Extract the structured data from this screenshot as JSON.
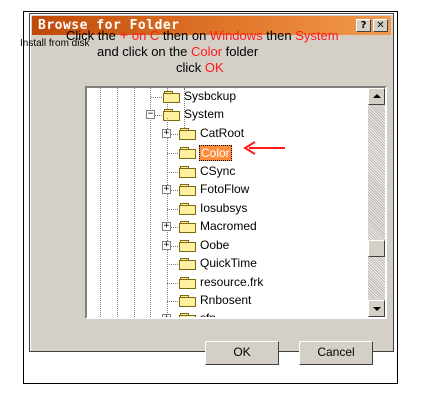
{
  "dialog": {
    "title": "Browse for Folder",
    "help_button": "?",
    "close_button": "✕",
    "ok_label": "OK",
    "cancel_label": "Cancel"
  },
  "instructions": {
    "line1_a": "Click the ",
    "line1_plus": "+",
    "line1_b": " on C",
    "line1_c": " then on ",
    "line1_d": "Windows",
    "line1_e": " then ",
    "line1_f": "System",
    "side_note": "Install from disk",
    "line2_a": "and click on the ",
    "line2_b": "Color",
    "line2_c": " folder",
    "line3_a": "click ",
    "line3_b": "OK"
  },
  "tree": {
    "items": [
      {
        "label": "Sysbckup",
        "expander": ""
      },
      {
        "label": "System",
        "expander": "−"
      },
      {
        "label": "CatRoot",
        "expander": "+"
      },
      {
        "label": "Color",
        "expander": "",
        "selected": true
      },
      {
        "label": "CSync",
        "expander": ""
      },
      {
        "label": "FotoFlow",
        "expander": "+"
      },
      {
        "label": "Iosubsys",
        "expander": ""
      },
      {
        "label": "Macromed",
        "expander": "+"
      },
      {
        "label": "Oobe",
        "expander": "+"
      },
      {
        "label": "QuickTime",
        "expander": ""
      },
      {
        "label": "resource.frk",
        "expander": ""
      },
      {
        "label": "Rnbosent",
        "expander": ""
      },
      {
        "label": "sfp",
        "expander": "+"
      }
    ]
  },
  "colors": {
    "title_gradient_start": "#c04a08",
    "annotation_red": "#ff1a1a",
    "selection": "#ff8c3a"
  },
  "icons": {
    "folder": "folder-icon",
    "annotation": "red-arrow-icon"
  }
}
